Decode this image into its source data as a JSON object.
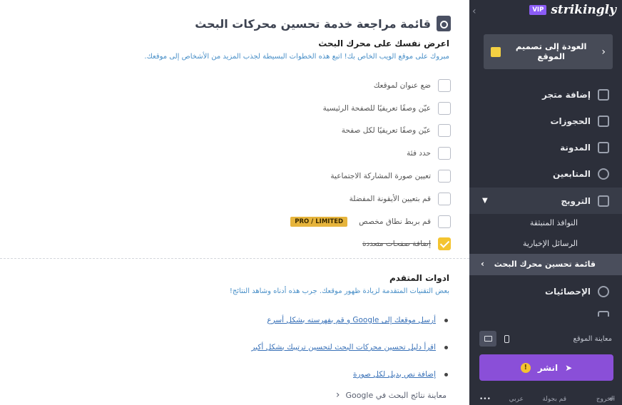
{
  "main": {
    "title": "قائمة مراجعة خدمة تحسين محركات البحث",
    "section1": {
      "heading": "اعرض نفسك على محرك البحث",
      "subtitle": "مبروك على موقع الويب الخاص بك! اتبع هذه الخطوات البسيطة لجذب المزيد من الأشخاص إلى موقعك."
    },
    "checklist": [
      {
        "label": "ضع عنوان لموقعك",
        "checked": false
      },
      {
        "label": "عيّن وصفًا تعريفيًا للصفحة الرئيسية",
        "checked": false
      },
      {
        "label": "عيّن وصفًا تعريفيًا لكل صفحة",
        "checked": false
      },
      {
        "label": "حدد فئة",
        "checked": false
      },
      {
        "label": "تعيين صورة المشاركة الاجتماعية",
        "checked": false
      },
      {
        "label": "قم بتعيين الأيقونة المفضلة",
        "checked": false
      },
      {
        "label": "قم بربط نطاق مخصص",
        "checked": false,
        "badge": "PRO / LIMITED"
      },
      {
        "label": "إضافة صفحات متعددة",
        "checked": true
      }
    ],
    "section2": {
      "heading": "ادوات المتقدم",
      "subtitle": "بعض التقنيات المتقدمة لزيادة ظهور موقعك. جرب هذه أدناه وشاهد النتائج!"
    },
    "tools": [
      "أرسل موقعك إلى Google و قم بفهرسته بشكل أسرع",
      "اقرأ دليل تحسين محركات البحث لتحسين ترتيبك بشكل أكبر",
      "إضافة نص بديل لكل صورة"
    ],
    "preview_google": "معاينة نتائج البحث في Google"
  },
  "sidebar": {
    "logo": "strikingly",
    "vip": "VIP",
    "back_button": "العودة إلى تصميم الموقع",
    "nav": [
      {
        "label": "إضافة متجر",
        "icon": "store-icon"
      },
      {
        "label": "الحجوزات",
        "icon": "calendar-icon"
      },
      {
        "label": "المدونة",
        "icon": "pen-icon"
      },
      {
        "label": "المتابعين",
        "icon": "followers-icon"
      },
      {
        "label": "الترويج",
        "icon": "megaphone-icon"
      }
    ],
    "sub_items": [
      "النوافذ المنبثقة",
      "الرسائل الإخبارية",
      "قائمة تحسين محرك البحث"
    ],
    "stats": "الإحصائيات",
    "preview_site": "معاينة الموقع",
    "publish": "انشر",
    "warn": "!",
    "bottom": {
      "exit": "الخروج",
      "tour": "قم بجولة",
      "language": "عربي",
      "more": "•••"
    }
  }
}
